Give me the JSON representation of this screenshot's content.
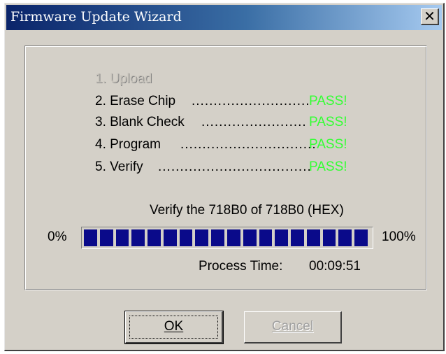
{
  "window": {
    "title": "Firmware Update Wizard",
    "close_symbol": "✕"
  },
  "steps": [
    {
      "label": "1. Upload",
      "dots": "",
      "result": "",
      "enabled": false
    },
    {
      "label": "2. Erase Chip",
      "dots": "...........................",
      "result": "PASS!",
      "enabled": true
    },
    {
      "label": "3. Blank Check",
      "dots": "........................",
      "result": "PASS!",
      "enabled": true
    },
    {
      "label": "4. Program",
      "dots": "...............................",
      "result": "PASS!",
      "enabled": true
    },
    {
      "label": "5. Verify",
      "dots": "...................................",
      "result": "PASS!",
      "enabled": true
    }
  ],
  "status": {
    "text": "Verify the 718B0 of 718B0 (HEX)"
  },
  "progress": {
    "min_label": "0%",
    "max_label": "100%",
    "fraction": 1.0,
    "block_count": 18
  },
  "process_time": {
    "label": "Process Time:",
    "value": "00:09:51"
  },
  "buttons": {
    "ok": "OK",
    "cancel": "Cancel"
  },
  "colors": {
    "pass": "#33ff33",
    "progress_block": "#0a0a8a"
  }
}
